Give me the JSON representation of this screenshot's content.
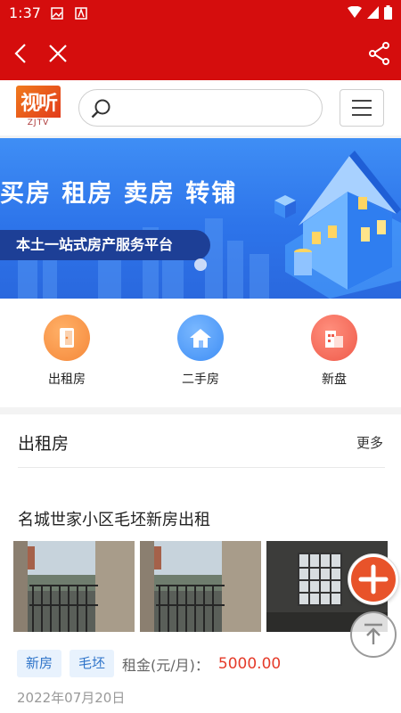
{
  "status_bar": {
    "time": "1:37"
  },
  "header": {
    "logo_text": "视听",
    "logo_sub": "ZJTV",
    "search": {
      "value": "",
      "placeholder": ""
    }
  },
  "banner": {
    "headline": "买房 租房 卖房 转铺",
    "slogan": "本土一站式房产服务平台"
  },
  "categories": [
    {
      "label": "出租房",
      "icon": "door-icon",
      "color": "#f5883a"
    },
    {
      "label": "二手房",
      "icon": "home-icon",
      "color": "#3f8ef5"
    },
    {
      "label": "新盘",
      "icon": "building-icon",
      "color": "#ef5a4a"
    }
  ],
  "section": {
    "title": "出租房",
    "more": "更多",
    "listing": {
      "title": "名城世家小区毛坯新房出租",
      "tags": [
        "新房",
        "毛坯"
      ],
      "rent_label": "租金(元/月)：",
      "price": "5000.00",
      "date": "2022年07月20日"
    }
  },
  "colors": {
    "brand_red": "#d50d0d",
    "banner_blue": "#2d74ea",
    "price_red": "#e53b2a",
    "tag_blue": "#2f74c9",
    "fab_orange": "#e8532a"
  }
}
